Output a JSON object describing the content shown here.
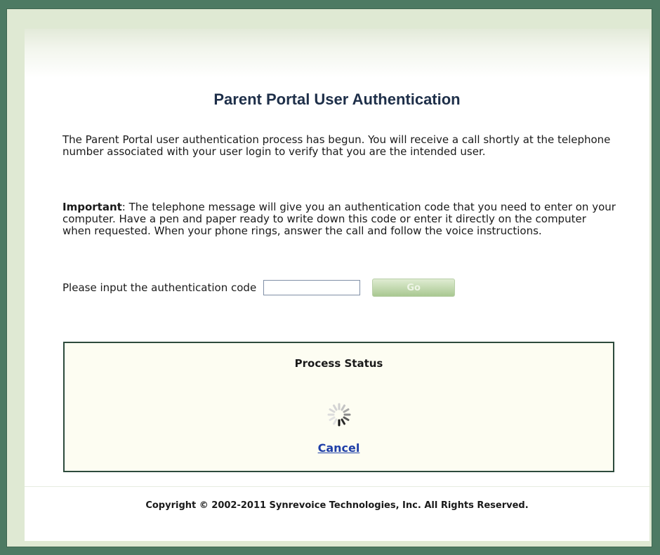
{
  "page": {
    "title": "Parent Portal User Authentication",
    "intro": "The Parent Portal user authentication process has begun. You will receive a call shortly at the telephone number associated with your user login to verify that you are the intended user.",
    "important_label": "Important",
    "important_text": ": The telephone message will give you an authentication code that you need to enter on your computer. Have a pen and paper ready to write down this code or enter it directly on the computer when requested. When your phone rings, answer the call and follow the voice instructions."
  },
  "auth_form": {
    "prompt": "Please input the authentication code",
    "code_value": "",
    "go_label": "Go"
  },
  "status": {
    "title": "Process Status",
    "spinner_icon": "loading-spinner-icon",
    "cancel_label": "Cancel"
  },
  "footer": {
    "copyright": "Copyright © 2002-2011 Synrevoice Technologies, Inc. All Rights Reserved."
  },
  "colors": {
    "frame": "#4d7a63",
    "title": "#1e2f49",
    "link": "#1f3fa8",
    "status_border": "#2d4b3c"
  }
}
